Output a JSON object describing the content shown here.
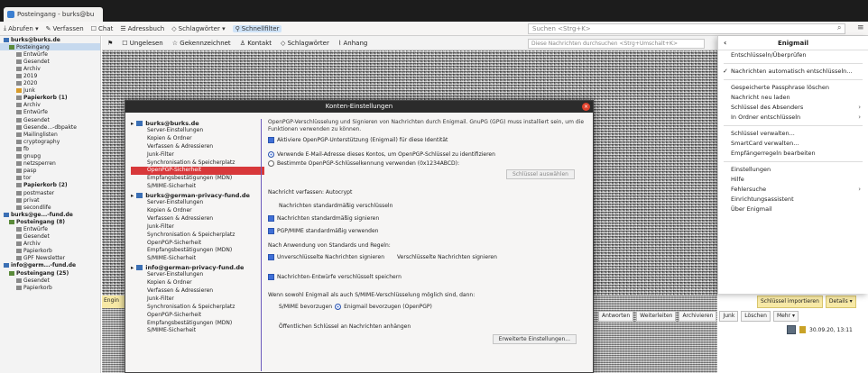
{
  "window": {
    "tab_title": "Posteingang - burks@bu"
  },
  "toolbar": {
    "items": [
      {
        "label": "Abrufen ▾"
      },
      {
        "label": "Verfassen"
      },
      {
        "label": "Chat"
      },
      {
        "label": "Adressbuch"
      },
      {
        "label": "Schlagwörter ▾"
      },
      {
        "label": "Schnellfilter"
      }
    ],
    "search_placeholder": "Suchen <Strg+K>"
  },
  "folders": [
    {
      "label": "burks@burks.de",
      "type": "acct",
      "bold": true
    },
    {
      "label": "Posteingang",
      "type": "inbox",
      "sel": true
    },
    {
      "label": "Entwürfe",
      "type": "plain"
    },
    {
      "label": "Gesendet",
      "type": "plain"
    },
    {
      "label": "Archiv",
      "type": "plain"
    },
    {
      "label": "2019",
      "type": "plain"
    },
    {
      "label": "2020",
      "type": "plain"
    },
    {
      "label": "Junk",
      "type": "junk"
    },
    {
      "label": "Papierkorb (1)",
      "type": "plain",
      "bold": true
    },
    {
      "label": "Archiv",
      "type": "plain"
    },
    {
      "label": "Entwürfe",
      "type": "plain"
    },
    {
      "label": "Gesendet",
      "type": "plain"
    },
    {
      "label": "Gesende...-dbpakte",
      "type": "plain"
    },
    {
      "label": "Mailinglisten",
      "type": "plain"
    },
    {
      "label": "cryptography",
      "type": "plain"
    },
    {
      "label": "fb",
      "type": "plain"
    },
    {
      "label": "gnupg",
      "type": "plain"
    },
    {
      "label": "netzsperren",
      "type": "plain"
    },
    {
      "label": "pasp",
      "type": "plain"
    },
    {
      "label": "tor",
      "type": "plain"
    },
    {
      "label": "Papierkorb (2)",
      "type": "plain",
      "bold": true
    },
    {
      "label": "postmaster",
      "type": "plain"
    },
    {
      "label": "privat",
      "type": "plain"
    },
    {
      "label": "secondlife",
      "type": "plain"
    },
    {
      "label": "burks@ge...-fund.de",
      "type": "acct",
      "bold": true
    },
    {
      "label": "Posteingang (8)",
      "type": "inbox",
      "bold": true
    },
    {
      "label": "Entwürfe",
      "type": "plain"
    },
    {
      "label": "Gesendet",
      "type": "plain"
    },
    {
      "label": "Archiv",
      "type": "plain"
    },
    {
      "label": "Papierkorb",
      "type": "plain"
    },
    {
      "label": "GPF Newsletter",
      "type": "plain"
    },
    {
      "label": "info@germ...-fund.de",
      "type": "acct",
      "bold": true
    },
    {
      "label": "Posteingang (25)",
      "type": "inbox",
      "bold": true
    },
    {
      "label": "Gesendet",
      "type": "plain"
    },
    {
      "label": "Papierkorb",
      "type": "plain"
    }
  ],
  "message_header": {
    "items": [
      "Ungelesen",
      "Gekennzeichnet",
      "Kontakt",
      "Schlagwörter",
      "Anhang"
    ],
    "filter_placeholder": "Diese Nachrichten durchsuchen <Strg+Umschalt+K>"
  },
  "lower_left_label": "Engin",
  "right_buttons": {
    "b1": "Schlüssel importieren",
    "b2": "Details ▾"
  },
  "actions": [
    "Antworten",
    "Weiterleiten",
    "Archivieren",
    "Junk",
    "Löschen",
    "Mehr ▾"
  ],
  "date": "30.09.20, 13:11",
  "dialog": {
    "title": "Konten-Einstellungen",
    "accounts": [
      {
        "name": "burks@burks.de",
        "items": [
          "Server-Einstellungen",
          "Kopien & Ordner",
          "Verfassen & Adressieren",
          "Junk-Filter",
          "Synchronisation & Speicherplatz",
          "OpenPGP-Sicherheit",
          "Empfangsbestätigungen (MDN)",
          "S/MIME-Sicherheit"
        ],
        "selected_index": 5
      },
      {
        "name": "burks@german-privacy-fund.de",
        "items": [
          "Server-Einstellungen",
          "Kopien & Ordner",
          "Verfassen & Adressieren",
          "Junk-Filter",
          "Synchronisation & Speicherplatz",
          "OpenPGP-Sicherheit",
          "Empfangsbestätigungen (MDN)",
          "S/MIME-Sicherheit"
        ],
        "selected_index": -1
      },
      {
        "name": "info@german-privacy-fund.de",
        "items": [
          "Server-Einstellungen",
          "Kopien & Ordner",
          "Verfassen & Adressieren",
          "Junk-Filter",
          "Synchronisation & Speicherplatz",
          "OpenPGP-Sicherheit",
          "Empfangsbestätigungen (MDN)",
          "S/MIME-Sicherheit"
        ],
        "selected_index": -1
      }
    ],
    "intro": "OpenPGP-Verschlüsselung und Signieren von Nachrichten durch Enigmail. GnuPG (GPG) muss installiert sein, um die Funktionen verwenden zu können.",
    "enable_label": "Aktiviere OpenPGP-Unterstützung (Enigmail) für diese Identität",
    "email_key_label": "Verwende E-Mail-Adresse dieses Kontos, um OpenPGP-Schlüssel zu identifizieren",
    "specific_key_label": "Bestimmte OpenPGP-Schlüsselkennung verwenden (0x1234ABCD):",
    "select_key_button": "Schlüssel auswählen",
    "compose_heading": "Nachricht verfassen: Autocrypt",
    "opt_encrypt": "Nachrichten standardmäßig verschlüsseln",
    "opt_sign": "Nachrichten standardmäßig signieren",
    "opt_pgpmime": "PGP/MIME standardmäßig verwenden",
    "after_rules_heading": "Nach Anwendung von Standards und Regeln:",
    "opt_sign_unencrypted": "Unverschlüsselte Nachrichten signieren",
    "opt_sign_encrypted": "Verschlüsselte Nachrichten signieren",
    "opt_drafts": "Nachrichten-Entwürfe verschlüsselt speichern",
    "both_possible": "Wenn sowohl Enigmail als auch S/MIME-Verschlüsselung möglich sind, dann:",
    "prefer_smime": "S/MIME bevorzugen",
    "prefer_enigmail": "Enigmail bevorzugen (OpenPGP)",
    "attach_pubkey": "Öffentlichen Schlüssel an Nachrichten anhängen",
    "advanced_button": "Erweiterte Einstellungen..."
  },
  "enigmail_menu": {
    "title": "Enigmail",
    "groups": [
      [
        {
          "label": "Entschlüsseln/Überprüfen"
        }
      ],
      [
        {
          "label": "Nachrichten automatisch entschlüsseln...",
          "check": true
        }
      ],
      [
        {
          "label": "Gespeicherte Passphrase löschen"
        },
        {
          "label": "Nachricht neu laden"
        },
        {
          "label": "Schlüssel des Absenders",
          "sub": true
        },
        {
          "label": "In Ordner entschlüsseln",
          "sub": true
        }
      ],
      [
        {
          "label": "Schlüssel verwalten..."
        },
        {
          "label": "SmartCard verwalten..."
        },
        {
          "label": "Empfängerregeln bearbeiten"
        }
      ],
      [
        {
          "label": "Einstellungen"
        },
        {
          "label": "Hilfe"
        },
        {
          "label": "Fehlersuche",
          "sub": true
        },
        {
          "label": "Einrichtungsassistent"
        },
        {
          "label": "Über Enigmail"
        }
      ]
    ]
  }
}
